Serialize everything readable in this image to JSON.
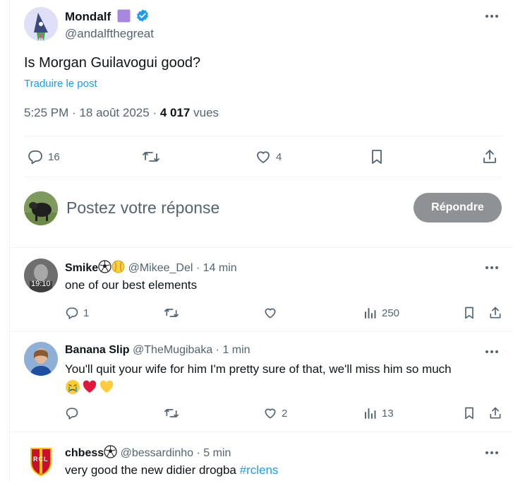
{
  "main_tweet": {
    "author": {
      "name": "Mondalf",
      "handle": "@andalfthegreat"
    },
    "text": "Is Morgan Guilavogui good?",
    "translate_label": "Traduire le post",
    "time": "5:25 PM",
    "date": "18 août 2025",
    "views_count": "4 017",
    "views_label": "vues",
    "stats": {
      "replies": "16",
      "likes": "4"
    }
  },
  "composer": {
    "placeholder": "Postez votre réponse",
    "button_label": "Répondre"
  },
  "replies": [
    {
      "name": "Smike",
      "handle": "@Mikee_Del",
      "time": "14 min",
      "avatar_label": "19:10",
      "text": "one of our best elements",
      "stats": {
        "replies": "1",
        "views": "250"
      }
    },
    {
      "name": "Banana Slip",
      "handle": "@TheMugibaka",
      "time": "1 min",
      "text": "You'll quit your wife for him I'm pretty sure of that, we'll miss him so much",
      "stats": {
        "likes": "2",
        "views": "13"
      }
    },
    {
      "name": "chbess",
      "handle": "@bessardinho",
      "time": "5 min",
      "avatar_label": "RCL",
      "text": "very good the new didier drogba ",
      "hashtag": "#rclens"
    }
  ],
  "colors": {
    "accent": "#1d9bf0",
    "verified": "#1d9bf0",
    "text": "#0f1419",
    "muted": "#536471",
    "border": "#eff3f4",
    "button_disabled": "#8f9295"
  },
  "icons": [
    "verified-badge-icon",
    "purple-square-icon",
    "more-icon",
    "reply-icon",
    "retweet-icon",
    "like-icon",
    "bookmark-icon",
    "share-icon",
    "views-icon",
    "soccer-ball-icon",
    "softball-icon",
    "crying-face-icon",
    "red-heart-icon",
    "yellow-heart-icon"
  ]
}
